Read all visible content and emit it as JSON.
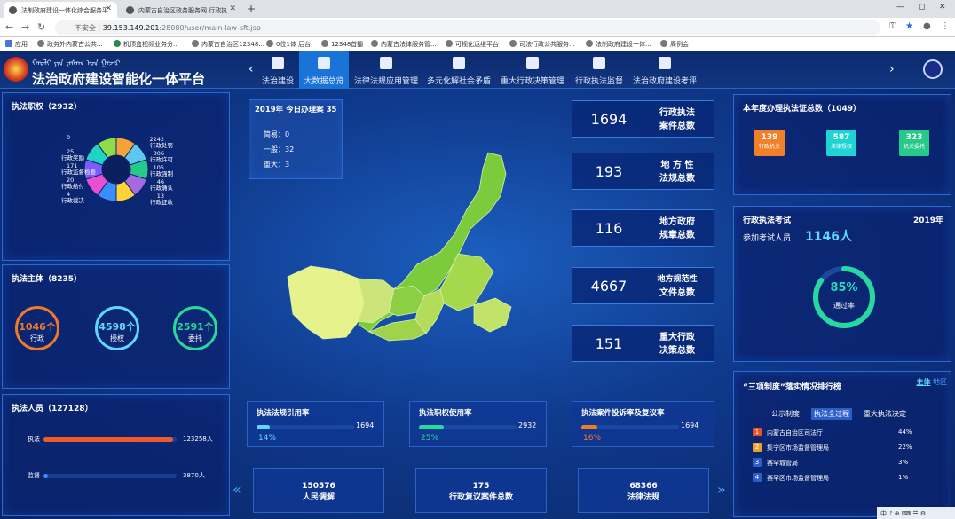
{
  "browser": {
    "tabs": [
      {
        "title": "法制政府建设一体化综合服务平...",
        "active": true
      },
      {
        "title": "内蒙古自治区政务服务网 行政执...",
        "active": false
      }
    ],
    "new_tab": "+",
    "security_label": "不安全",
    "url_host": "39.153.149.201",
    "url_path": ":28080/user/main-law-sft.jsp",
    "bookmarks": [
      "应用",
      "政务外内蒙古公共...",
      "机顶盒视频业务分...",
      "内蒙古自治区12348...",
      "0位1体 后台",
      "12348首播",
      "内蒙古法律服务管...",
      "可视化运维平台",
      "司法行政公共服务...",
      "法制政府建设一体...",
      "周例会"
    ]
  },
  "header": {
    "mongol_text": "ᠬᠠᠤᠯᠢ ᠶᠢᠨ ᠵᠠᠰᠠᠭ ᠤᠨ ᠭᠠᠵᠠᠷ",
    "title": "法治政府建设智能化一体平台",
    "prev_arrow": "‹",
    "next_arrow": "›",
    "nav": [
      "法治建设",
      "大数据总览",
      "法律法规应用管理",
      "多元化解社会矛盾",
      "重大行政决策管理",
      "行政执法监督",
      "法治政府建设考评"
    ],
    "active_index": 1
  },
  "left": {
    "powers": {
      "title": "执法职权（2932）",
      "slices": [
        {
          "label": "行政处罚",
          "value": 2242,
          "color": "#f2a43a"
        },
        {
          "label": "行政许可",
          "value": 306,
          "color": "#5fc6f0"
        },
        {
          "label": "行政强制",
          "value": 105,
          "color": "#27c98a"
        },
        {
          "label": "行政确认",
          "value": 46,
          "color": "#a46be0"
        },
        {
          "label": "行政征收",
          "value": 13,
          "color": "#ffd23a"
        },
        {
          "label": "行政裁决",
          "value": 4,
          "color": "#3a8cff"
        },
        {
          "label": "行政给付",
          "value": 20,
          "color": "#ea4fd1"
        },
        {
          "label": "行政监督检查",
          "value": 171,
          "color": "#7a5cff"
        },
        {
          "label": "行政奖励",
          "value": 25,
          "color": "#1fd3c6"
        },
        {
          "label": "其他",
          "value": 0,
          "color": "#8fdc4a"
        }
      ],
      "label_left": [
        {
          "value": "0",
          "label": ""
        },
        {
          "value": "25",
          "label": "行政奖励"
        },
        {
          "value": "171",
          "label": "行政监督检查"
        },
        {
          "value": "20",
          "label": "行政给付"
        },
        {
          "value": "4",
          "label": "行政裁决"
        }
      ],
      "label_right": [
        {
          "value": "2242",
          "label": "行政处罚"
        },
        {
          "value": "306",
          "label": "行政许可"
        },
        {
          "value": "105",
          "label": "行政强制"
        },
        {
          "value": "46",
          "label": "行政确认"
        },
        {
          "value": "13",
          "label": "行政征收"
        }
      ]
    },
    "subjects": {
      "title": "执法主体（8235）",
      "items": [
        {
          "value": "1046个",
          "label": "行政",
          "color": "#f07a2a"
        },
        {
          "value": "4598个",
          "label": "授权",
          "color": "#5fd7ff"
        },
        {
          "value": "2591个",
          "label": "委托",
          "color": "#27d99a"
        }
      ]
    },
    "personnel": {
      "title": "执法人员（127128）",
      "rows": [
        {
          "label": "执法",
          "value": "123258人",
          "fraction": 0.97,
          "color": "#f05a2a"
        },
        {
          "label": "监督",
          "value": "3870人",
          "fraction": 0.03,
          "color": "#3a8cff"
        }
      ]
    }
  },
  "center": {
    "today": {
      "year_label": "2019年",
      "title": "今日办理案",
      "count": "35",
      "rows": [
        {
          "label": "简易：",
          "value": "0"
        },
        {
          "label": "一般：",
          "value": "32"
        },
        {
          "label": "重大：",
          "value": "3"
        }
      ]
    },
    "kpis": [
      {
        "value": "1694",
        "label1": "行政执法",
        "label2": "案件总数"
      },
      {
        "value": "193",
        "label1": "地 方 性",
        "label2": "法规总数"
      },
      {
        "value": "116",
        "label1": "地方政府",
        "label2": "规章总数"
      },
      {
        "value": "4667",
        "label1": "地方规范性",
        "label2": "文件总数"
      },
      {
        "value": "151",
        "label1": "重大行政",
        "label2": "决策总数"
      }
    ],
    "rates": [
      {
        "title": "执法法规引用率",
        "value": "1694",
        "percent": "14%",
        "fraction": 0.14,
        "color": "#5fd7ff"
      },
      {
        "title": "执法职权使用率",
        "value": "2932",
        "percent": "25%",
        "fraction": 0.25,
        "color": "#27d99a"
      },
      {
        "title": "执法案件投诉率及复议率",
        "value": "1694",
        "percent": "16%",
        "fraction": 0.16,
        "color": "#f07a2a"
      }
    ],
    "bottom": [
      {
        "value": "150576",
        "label": "人民调解"
      },
      {
        "value": "175",
        "label": "行政复议案件总数"
      },
      {
        "value": "68366",
        "label": "法律法规"
      }
    ],
    "chev_left": "«",
    "chev_right": "»"
  },
  "right": {
    "certs": {
      "title": "本年度办理执法证总数（1049）",
      "items": [
        {
          "value": "139",
          "label": "行政机关",
          "color": "#f0802a"
        },
        {
          "value": "587",
          "label": "法律授权",
          "color": "#1fd3d3"
        },
        {
          "value": "323",
          "label": "机关委托",
          "color": "#27c98a"
        }
      ]
    },
    "exam": {
      "title": "行政执法考试",
      "year": "2019年",
      "participants_label": "参加考试人员",
      "participants": "1146人",
      "pass_percent": "85%",
      "pass_fraction": 0.85,
      "pass_label": "通过率"
    },
    "ranking": {
      "title": "“三项制度”落实情况排行榜",
      "switch": [
        "主体",
        "地区"
      ],
      "tabs": [
        "公示制度",
        "执法全过程",
        "重大执法决定"
      ],
      "active_tab": 1,
      "rows": [
        {
          "rank": "1",
          "name": "内蒙古自治区司法厅",
          "percent": "44%",
          "color": "#e8502a"
        },
        {
          "rank": "2",
          "name": "集宁区市场监督管理局",
          "percent": "22%",
          "color": "#f0a02a"
        },
        {
          "rank": "3",
          "name": "赛罕城管局",
          "percent": "3%",
          "color": "#2c60c8"
        },
        {
          "rank": "4",
          "name": "赛罕区市场监督管理局",
          "percent": "1%",
          "color": "#2c60c8"
        }
      ]
    }
  },
  "taskbar": {
    "text": "中 ♪ ⊕ ⌨ ☰ ⚙"
  }
}
